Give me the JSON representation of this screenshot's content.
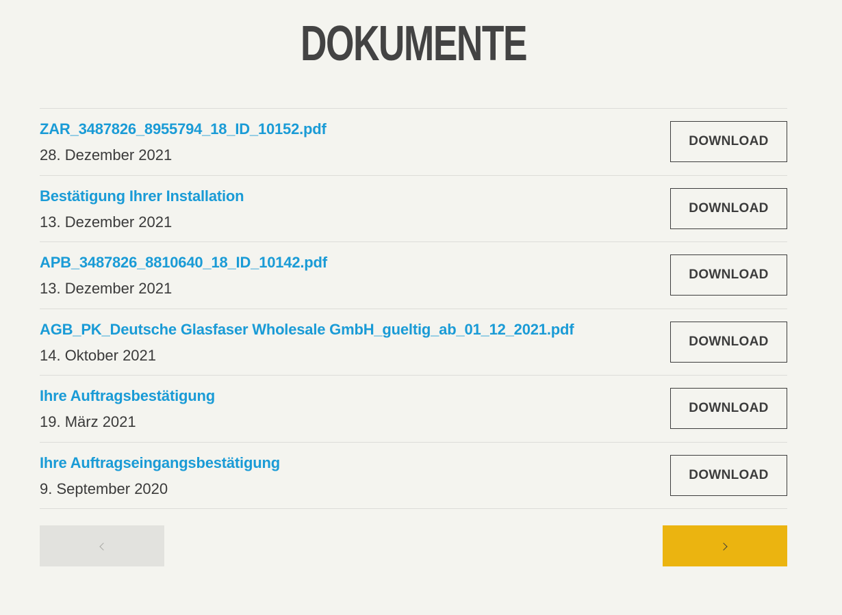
{
  "page": {
    "title": "DOKUMENTE"
  },
  "documents": [
    {
      "title": "ZAR_3487826_8955794_18_ID_10152.pdf",
      "date": "28. Dezember 2021",
      "action": "DOWNLOAD"
    },
    {
      "title": "Bestätigung Ihrer Installation",
      "date": "13. Dezember 2021",
      "action": "DOWNLOAD"
    },
    {
      "title": "APB_3487826_8810640_18_ID_10142.pdf",
      "date": "13. Dezember 2021",
      "action": "DOWNLOAD"
    },
    {
      "title": "AGB_PK_Deutsche Glasfaser Wholesale GmbH_gueltig_ab_01_12_2021.pdf",
      "date": "14. Oktober 2021",
      "action": "DOWNLOAD"
    },
    {
      "title": "Ihre Auftragsbestätigung",
      "date": "19. März 2021",
      "action": "DOWNLOAD"
    },
    {
      "title": "Ihre Auftragseingangsbestätigung",
      "date": "9. September 2020",
      "action": "DOWNLOAD"
    }
  ],
  "pagination": {
    "prev_icon": "chevron-left-icon",
    "next_icon": "chevron-right-icon",
    "prev_color": "#e2e2de",
    "next_color": "#ebb410"
  },
  "colors": {
    "background": "#f4f4ef",
    "link": "#1a9bd6",
    "text": "#3a3a3a",
    "title": "#434343"
  }
}
